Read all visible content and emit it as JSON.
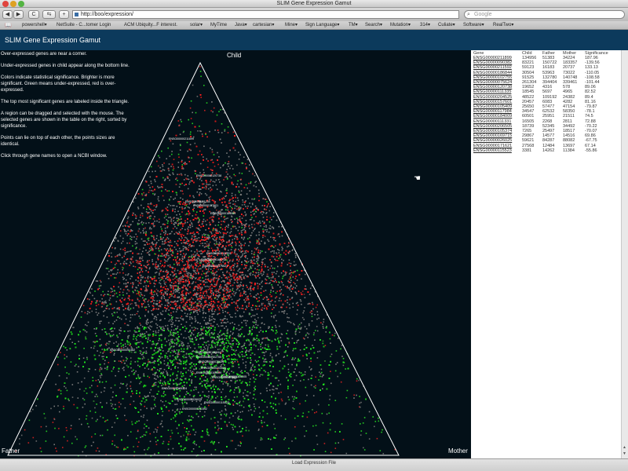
{
  "window": {
    "title": "SLIM Gene Expression Gamut"
  },
  "toolbar": {
    "back": "◀",
    "forward": "▶",
    "reload": "C",
    "history": "⇆",
    "add": "+",
    "url": "http://boo/expression/",
    "search_placeholder": "Google"
  },
  "bookmarks": [
    "powershell▾",
    "NetSuite - C...tomer Login",
    "ACM Ubiquity...F interest.",
    "solar▾",
    "MyTime",
    "Java▾",
    "cartesian▾",
    "Mine▾",
    "Sign Language▾",
    "TM▾",
    "Search▾",
    "Mutation▾",
    "314▾",
    "Culiate▾",
    "Software▾",
    "RealTwo▾"
  ],
  "app": {
    "title": "SLIM Gene Expression Gamut"
  },
  "info": [
    "Over-expressed genes are near a corner.",
    "Under-expressed genes in child appear along the bottom line.",
    "Colors indicate statistical significance. Brighter is more significant. Green means under-expressed, red is over-expressed.",
    "The top most significant genes are labeled inside the triangle.",
    "A region can be dragged and selected with the mouse. The selected genes are shown in the table on the right, sorted by significance.",
    "Points can lie on top of each other, the points sizes are identical.",
    "Click through gene names to open a NCBI window."
  ],
  "corners": {
    "top": "Child",
    "left": "Father",
    "right": "Mother"
  },
  "table": {
    "headers": [
      "Gene",
      "Child",
      "Father",
      "Mother",
      "Significance"
    ],
    "rows": [
      [
        "ENSG00000211899",
        "134956",
        "51383",
        "34224",
        "187.96"
      ],
      [
        "ENSG00000090382",
        "83221",
        "150722",
        "183357",
        "-139.56"
      ],
      [
        "ENSG00000211592",
        "59123",
        "16183",
        "20737",
        "133.13"
      ],
      [
        "ENSG00000186844",
        "30504",
        "53963",
        "73022",
        "-110.05"
      ],
      [
        "ENSG00000102755",
        "91525",
        "132780",
        "140748",
        "-108.58"
      ],
      [
        "ENSG00000075624",
        "261304",
        "394404",
        "339461",
        "-101.44"
      ],
      [
        "ENSG00000120738",
        "19652",
        "4316",
        "578",
        "89.06"
      ],
      [
        "ENSG00000111335",
        "18545",
        "5697",
        "4965",
        "82.52"
      ],
      [
        "ENSG00000204525",
        "48522",
        "109192",
        "24382",
        "89.4"
      ],
      [
        "ENSG00000157601",
        "20457",
        "6083",
        "4282",
        "81.16"
      ],
      [
        "ENSG00000105409",
        "25650",
        "57477",
        "47154",
        "-79.87"
      ],
      [
        "ENSG00000117984",
        "34547",
        "62532",
        "58350",
        "-78.1"
      ],
      [
        "ENSG00000184009",
        "60501",
        "25951",
        "21511",
        "74.5"
      ],
      [
        "ENSG00000111331",
        "16505",
        "2268",
        "2811",
        "72.88"
      ],
      [
        "ENSG00000206505",
        "18739",
        "52345",
        "34492",
        "-70.22"
      ],
      [
        "ENSG00000105374",
        "7265",
        "25497",
        "18517",
        "-70.07"
      ],
      [
        "ENSG00000169715",
        "29867",
        "14577",
        "14516",
        "69.86"
      ],
      [
        "ENSG00000026025",
        "59621",
        "84287",
        "88082",
        "-67.75"
      ],
      [
        "ENSG00000171621",
        "27568",
        "12484",
        "13697",
        "67.14"
      ],
      [
        "ENSG00000115523",
        "3381",
        "14262",
        "11384",
        "-55.86"
      ]
    ]
  },
  "plot_labels": [
    "ENSG00000211899",
    "ENSG00000120738",
    "ENSG00000111335",
    "ENSG00000157601",
    "ENSG00000184009",
    "ENSG00000111331",
    "ENSG00000169715",
    "ENSG00000171621",
    "ENSG00000090382",
    "ENSG00000186844",
    "ENSG00000102755",
    "ENSG00000075624",
    "ENSG00000204525",
    "ENSG00000105409",
    "ENSG00000117984",
    "ENSG00000206505",
    "ENSG00000105374",
    "ENSG00000026025",
    "ENSG00000115523",
    "ENSG00000211592"
  ],
  "footer": {
    "button": "Load Expression File"
  }
}
